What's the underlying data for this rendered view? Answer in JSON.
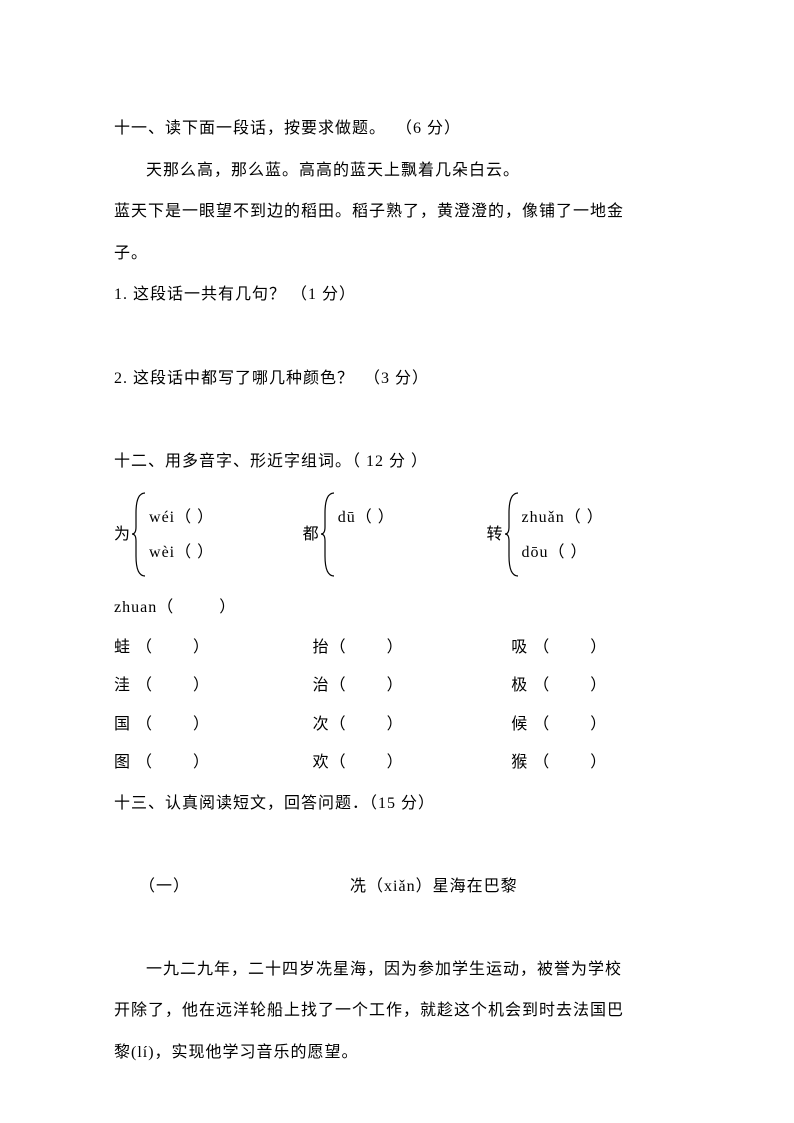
{
  "section11": {
    "heading": "十一、读下面一段话，按要求做题。  （6 分）",
    "para1": "天那么高，那么蓝。高高的蓝天上飘着几朵白云。",
    "para2a": "蓝天下是一眼望不到边的稻田。稻子熟了，黄澄澄的，像铺了一地金",
    "para2b": "子。",
    "q1": "1. 这段话一共有几句？ （1 分）",
    "q2": "2. 这段话中都写了哪几种颜色？  （3 分）"
  },
  "section12": {
    "heading": "十二、用多音字、形近字组词。（ 12 分 ）",
    "poly": [
      {
        "char": "为",
        "top": "wéi（        ）",
        "bottom": "wèi（          ）"
      },
      {
        "char": "都",
        "top": "dū（        ）",
        "bottom": ""
      },
      {
        "char": "转",
        "top": "zhuǎn（       ）",
        "bottom": "dōu（         ）"
      }
    ],
    "zhuan_extra": "zhuan（         ）",
    "similar": [
      [
        {
          "l": "蛙 （",
          "r": "）"
        },
        {
          "l": "抬（",
          "r": "）"
        },
        {
          "l": "吸 （",
          "r": "）"
        }
      ],
      [
        {
          "l": "洼 （",
          "r": "）"
        },
        {
          "l": "治（",
          "r": "）"
        },
        {
          "l": "极 （",
          "r": "）"
        }
      ],
      [
        {
          "l": "国 （",
          "r": "）"
        },
        {
          "l": "次（",
          "r": "）"
        },
        {
          "l": "候 （",
          "r": "）"
        }
      ],
      [
        {
          "l": "图 （",
          "r": "）"
        },
        {
          "l": "欢（",
          "r": "）"
        },
        {
          "l": "猴 （",
          "r": "）"
        }
      ]
    ]
  },
  "section13": {
    "heading": "十三、认真阅读短文，回答问题．（15 分）",
    "subtitle_prefix": " （一）",
    "subtitle": "冼（xiǎn）星海在巴黎",
    "p1a": "一九二九年，二十四岁冼星海，因为参加学生运动，被誉为学校",
    "p1b": "开除了，他在远洋轮船上找了一个工作，就趁这个机会到时去法国巴",
    "p1c": "黎(lí)，实现他学习音乐的愿望。"
  }
}
